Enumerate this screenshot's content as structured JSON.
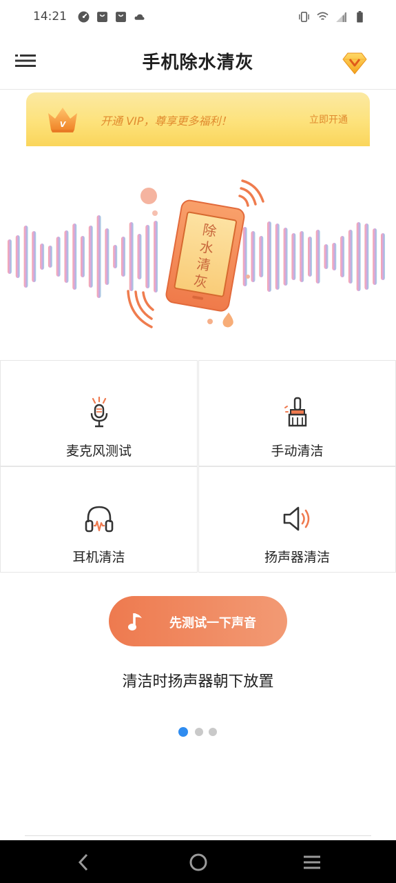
{
  "status_bar": {
    "time": "14:21",
    "left_icons": [
      "speed-gauge-icon",
      "shopping-bag-icon",
      "shopping-bag-icon",
      "cloud-icon"
    ],
    "right_icons": [
      "vibrate-icon",
      "wifi-icon",
      "cellular-signal-icon",
      "battery-icon"
    ]
  },
  "header": {
    "title": "手机除水清灰",
    "menu_icon": "menu-icon",
    "vip_icon": "diamond-icon"
  },
  "vip_banner": {
    "text": "开通 VIP，尊享更多福利！",
    "action": "立即开通",
    "crown_letter": "V"
  },
  "hero": {
    "screen_text": [
      "除",
      "水",
      "清",
      "灰"
    ]
  },
  "features": [
    {
      "label": "麦克风测试",
      "icon": "microphone-icon"
    },
    {
      "label": "手动清洁",
      "icon": "brush-icon"
    },
    {
      "label": "耳机清洁",
      "icon": "headphones-icon"
    },
    {
      "label": "扬声器清洁",
      "icon": "speaker-icon"
    }
  ],
  "test_button": {
    "label": "先测试一下声音",
    "icon": "music-note-icon"
  },
  "instruction": "清洁时扬声器朝下放置",
  "pager": {
    "count": 3,
    "active": 1
  },
  "colors": {
    "accent": "#ee7a4f",
    "vip_gold": "#fde27b",
    "pager_active": "#2f8cf0"
  },
  "nav": {
    "back_icon": "back-icon",
    "home_icon": "home-icon",
    "recents_icon": "recents-icon"
  }
}
